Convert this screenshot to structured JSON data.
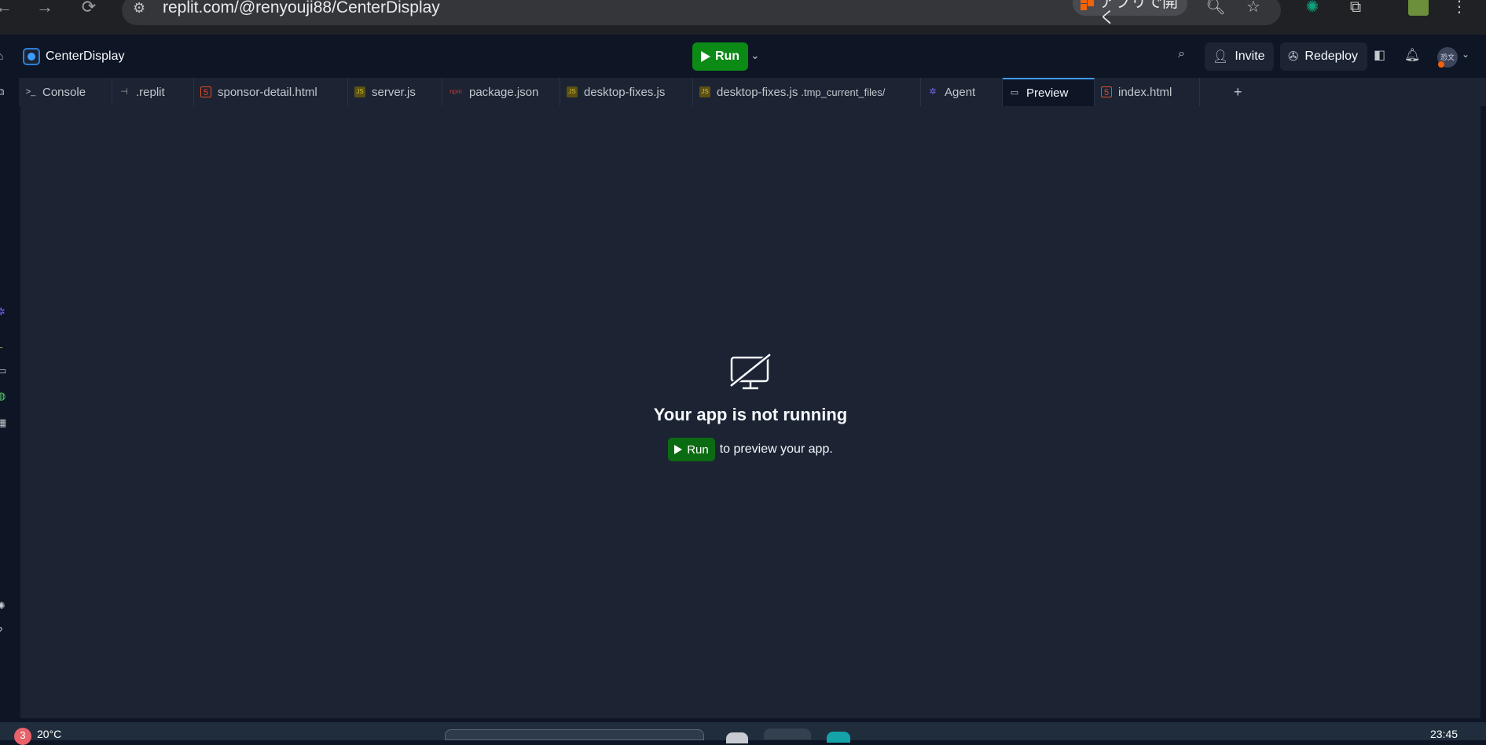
{
  "browser": {
    "url": "replit.com/@renyouji88/CenterDisplay",
    "open_in_app": "アプリで開く",
    "back_icon": "arrow-left-icon",
    "forward_icon": "arrow-right-icon",
    "reload_icon": "reload-icon"
  },
  "header": {
    "repl_name": "CenterDisplay",
    "run_label": "Run",
    "invite_label": "Invite",
    "redeploy_label": "Redeploy",
    "avatar_text": "恐文"
  },
  "tabs": [
    {
      "label": "Console",
      "icon": "terminal-icon",
      "icon_color": "#c2c8cc",
      "active": false
    },
    {
      "label": ".replit",
      "icon": "replit-config-icon",
      "icon_color": "#9da2a6",
      "active": false
    },
    {
      "label": "sponsor-detail.html",
      "icon": "html-file-icon",
      "icon_color": "#e44d26",
      "active": false
    },
    {
      "label": "server.js",
      "icon": "js-file-icon",
      "icon_color": "#cbb733",
      "active": false
    },
    {
      "label": "package.json",
      "icon": "npm-icon",
      "icon_color": "#cb3837",
      "active": false
    },
    {
      "label": "desktop-fixes.js",
      "icon": "js-file-icon",
      "icon_color": "#cbb733",
      "active": false
    },
    {
      "label": "desktop-fixes.js",
      "sub": ".tmp_current_files/",
      "icon": "js-file-icon",
      "icon_color": "#cbb733",
      "active": false
    },
    {
      "label": "Agent",
      "icon": "agent-icon",
      "icon_color": "#7c65f6",
      "active": false
    },
    {
      "label": "Preview",
      "icon": "monitor-icon",
      "icon_color": "#c2c8cc",
      "active": true
    },
    {
      "label": "index.html",
      "icon": "html-file-icon",
      "icon_color": "#e44d26",
      "active": false
    }
  ],
  "preview": {
    "title": "Your app is not running",
    "run_label": "Run",
    "hint": "to preview your app."
  },
  "taskbar": {
    "temp": "20°C",
    "badge": "3",
    "clock": "23:45"
  },
  "colors": {
    "run_green": "#0b8a16",
    "tab_active_border": "#3e9bff",
    "pane_bg": "#1c2333",
    "app_bg": "#0e1525"
  }
}
